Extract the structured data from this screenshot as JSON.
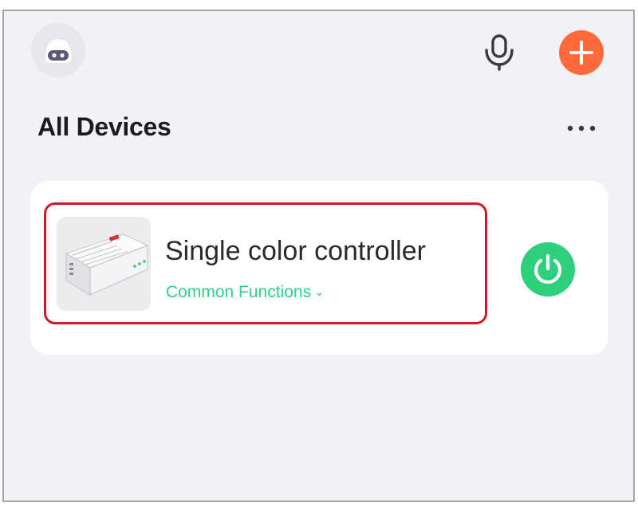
{
  "header": {
    "avatar_icon": "robot-avatar-icon",
    "mic_icon": "microphone-icon",
    "add_icon": "plus-icon",
    "accent_color": "#ff6a3d"
  },
  "section": {
    "title": "All Devices",
    "more_icon": "more-horizontal-icon"
  },
  "device": {
    "name": "Single color controller",
    "functions_label": "Common Functions",
    "functions_chevron": "⌄",
    "power_icon": "power-icon",
    "power_color": "#2ecf7d",
    "highlight_color": "#d01927"
  }
}
